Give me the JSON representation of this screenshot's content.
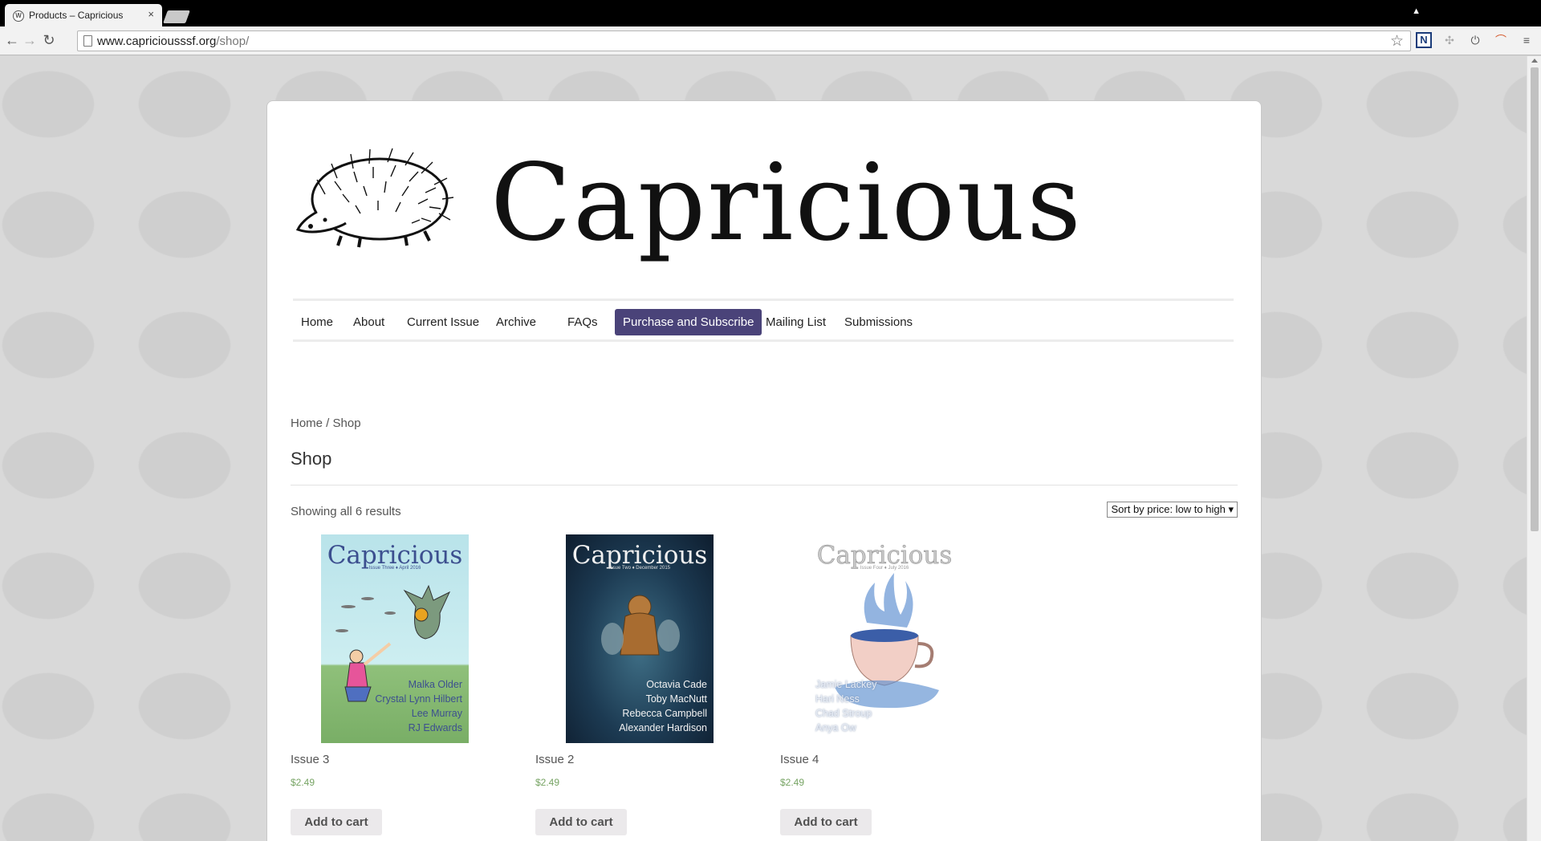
{
  "browser": {
    "tab_title": "Products – Capricious",
    "tab_close": "×",
    "url_host": "www.capriciousssf.org",
    "url_path": "/shop/"
  },
  "site": {
    "title": "Capricious",
    "logo": "hedgehog-illustration"
  },
  "nav": {
    "items": [
      {
        "label": "Home"
      },
      {
        "label": "About"
      },
      {
        "label": "Current Issue"
      },
      {
        "label": "Archive"
      },
      {
        "label": "FAQs"
      },
      {
        "label": "Purchase and Subscribe",
        "active": true
      },
      {
        "label": "Mailing List"
      },
      {
        "label": "Submissions"
      }
    ],
    "active_color": "#4a4379"
  },
  "breadcrumb": {
    "home": "Home",
    "separator": " / ",
    "current": "Shop"
  },
  "page_title": "Shop",
  "result_count": "Showing all 6 results",
  "sort": {
    "selected": "Sort by price: low to high"
  },
  "products": [
    {
      "name": "Issue 3",
      "price": "$2.49",
      "button": "Add to cart",
      "cover": {
        "title": "Capricious",
        "subtitle": "Issue Three ♦ April 2016",
        "names": [
          "Malka Older",
          "Crystal Lynn Hilbert",
          "Lee Murray",
          "RJ Edwards"
        ]
      }
    },
    {
      "name": "Issue 2",
      "price": "$2.49",
      "button": "Add to cart",
      "cover": {
        "title": "Capricious",
        "subtitle": "Issue Two ♦ December 2015",
        "names": [
          "Octavia Cade",
          "Toby MacNutt",
          "Rebecca Campbell",
          "Alexander Hardison"
        ]
      }
    },
    {
      "name": "Issue 4",
      "price": "$2.49",
      "button": "Add to cart",
      "cover": {
        "title": "Capricious",
        "subtitle": "Issue Four ♦ July 2016",
        "names": [
          "Jamie Lackey",
          "Hari Ness",
          "Chad Stroup",
          "Anya Ow"
        ]
      }
    }
  ],
  "price_color": "#77a464"
}
